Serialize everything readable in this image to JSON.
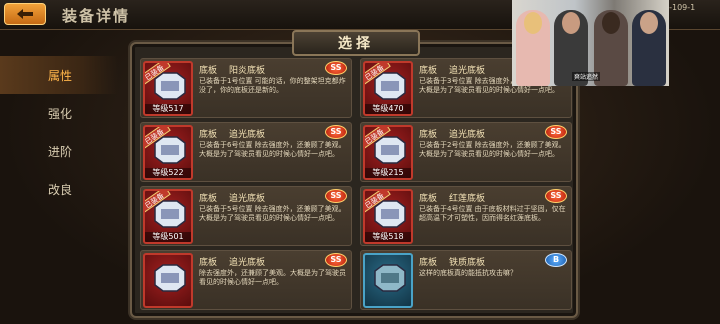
{
  "header": {
    "title": "装备详情",
    "code_text": "7-109-1"
  },
  "sidebar": {
    "items": [
      {
        "label": "属性",
        "active": true
      },
      {
        "label": "强化",
        "active": false
      },
      {
        "label": "进阶",
        "active": false
      },
      {
        "label": "改良",
        "active": false
      }
    ]
  },
  "dialog": {
    "title": "选择",
    "cards": [
      {
        "type": "底板",
        "name": "阳炎底板",
        "level": "等级517",
        "equipped": "已装备",
        "rank": "SS",
        "desc": "已装备于1号位置 可能的话，你的整架坦克都炸没了，你的底板还是新的。",
        "color": "red"
      },
      {
        "type": "底板",
        "name": "追光底板",
        "level": "等级470",
        "equipped": "已装备",
        "rank": "SS",
        "desc": "已装备于3号位置 除去强度外，还兼顾了美观。大概是为了驾驶员看见的时候心情好一点吧。",
        "color": "red"
      },
      {
        "type": "底板",
        "name": "追光底板",
        "level": "等级522",
        "equipped": "已装备",
        "rank": "SS",
        "desc": "已装备于6号位置 除去强度外，还兼顾了美观。大概是为了驾驶员看见的时候心情好一点吧。",
        "color": "red"
      },
      {
        "type": "底板",
        "name": "追光底板",
        "level": "等级215",
        "equipped": "已装备",
        "rank": "SS",
        "desc": "已装备于2号位置 除去强度外，还兼顾了美观。大概是为了驾驶员看见的时候心情好一点吧。",
        "color": "red"
      },
      {
        "type": "底板",
        "name": "追光底板",
        "level": "等级501",
        "equipped": "已装备",
        "rank": "SS",
        "desc": "已装备于5号位置 除去强度外，还兼顾了美观。大概是为了驾驶员看见的时候心情好一点吧。",
        "color": "red"
      },
      {
        "type": "底板",
        "name": "红莲底板",
        "level": "等级518",
        "equipped": "已装备",
        "rank": "SS",
        "desc": "已装备于4号位置 由于底板材料过于坚固，仅在超高温下才可塑性，因而得名红莲底板。",
        "color": "red"
      },
      {
        "type": "底板",
        "name": "追光底板",
        "level": "",
        "equipped": "",
        "rank": "SS",
        "desc": "除去强度外，还兼顾了美观。大概是为了驾驶员看见的时候心情好一点吧。",
        "color": "red"
      },
      {
        "type": "底板",
        "name": "铁质底板",
        "level": "",
        "equipped": "",
        "rank": "B",
        "desc": "这样的底板真的能抵抗攻击嘛？",
        "color": "blue"
      }
    ]
  },
  "video": {
    "label": "爽站追然"
  }
}
